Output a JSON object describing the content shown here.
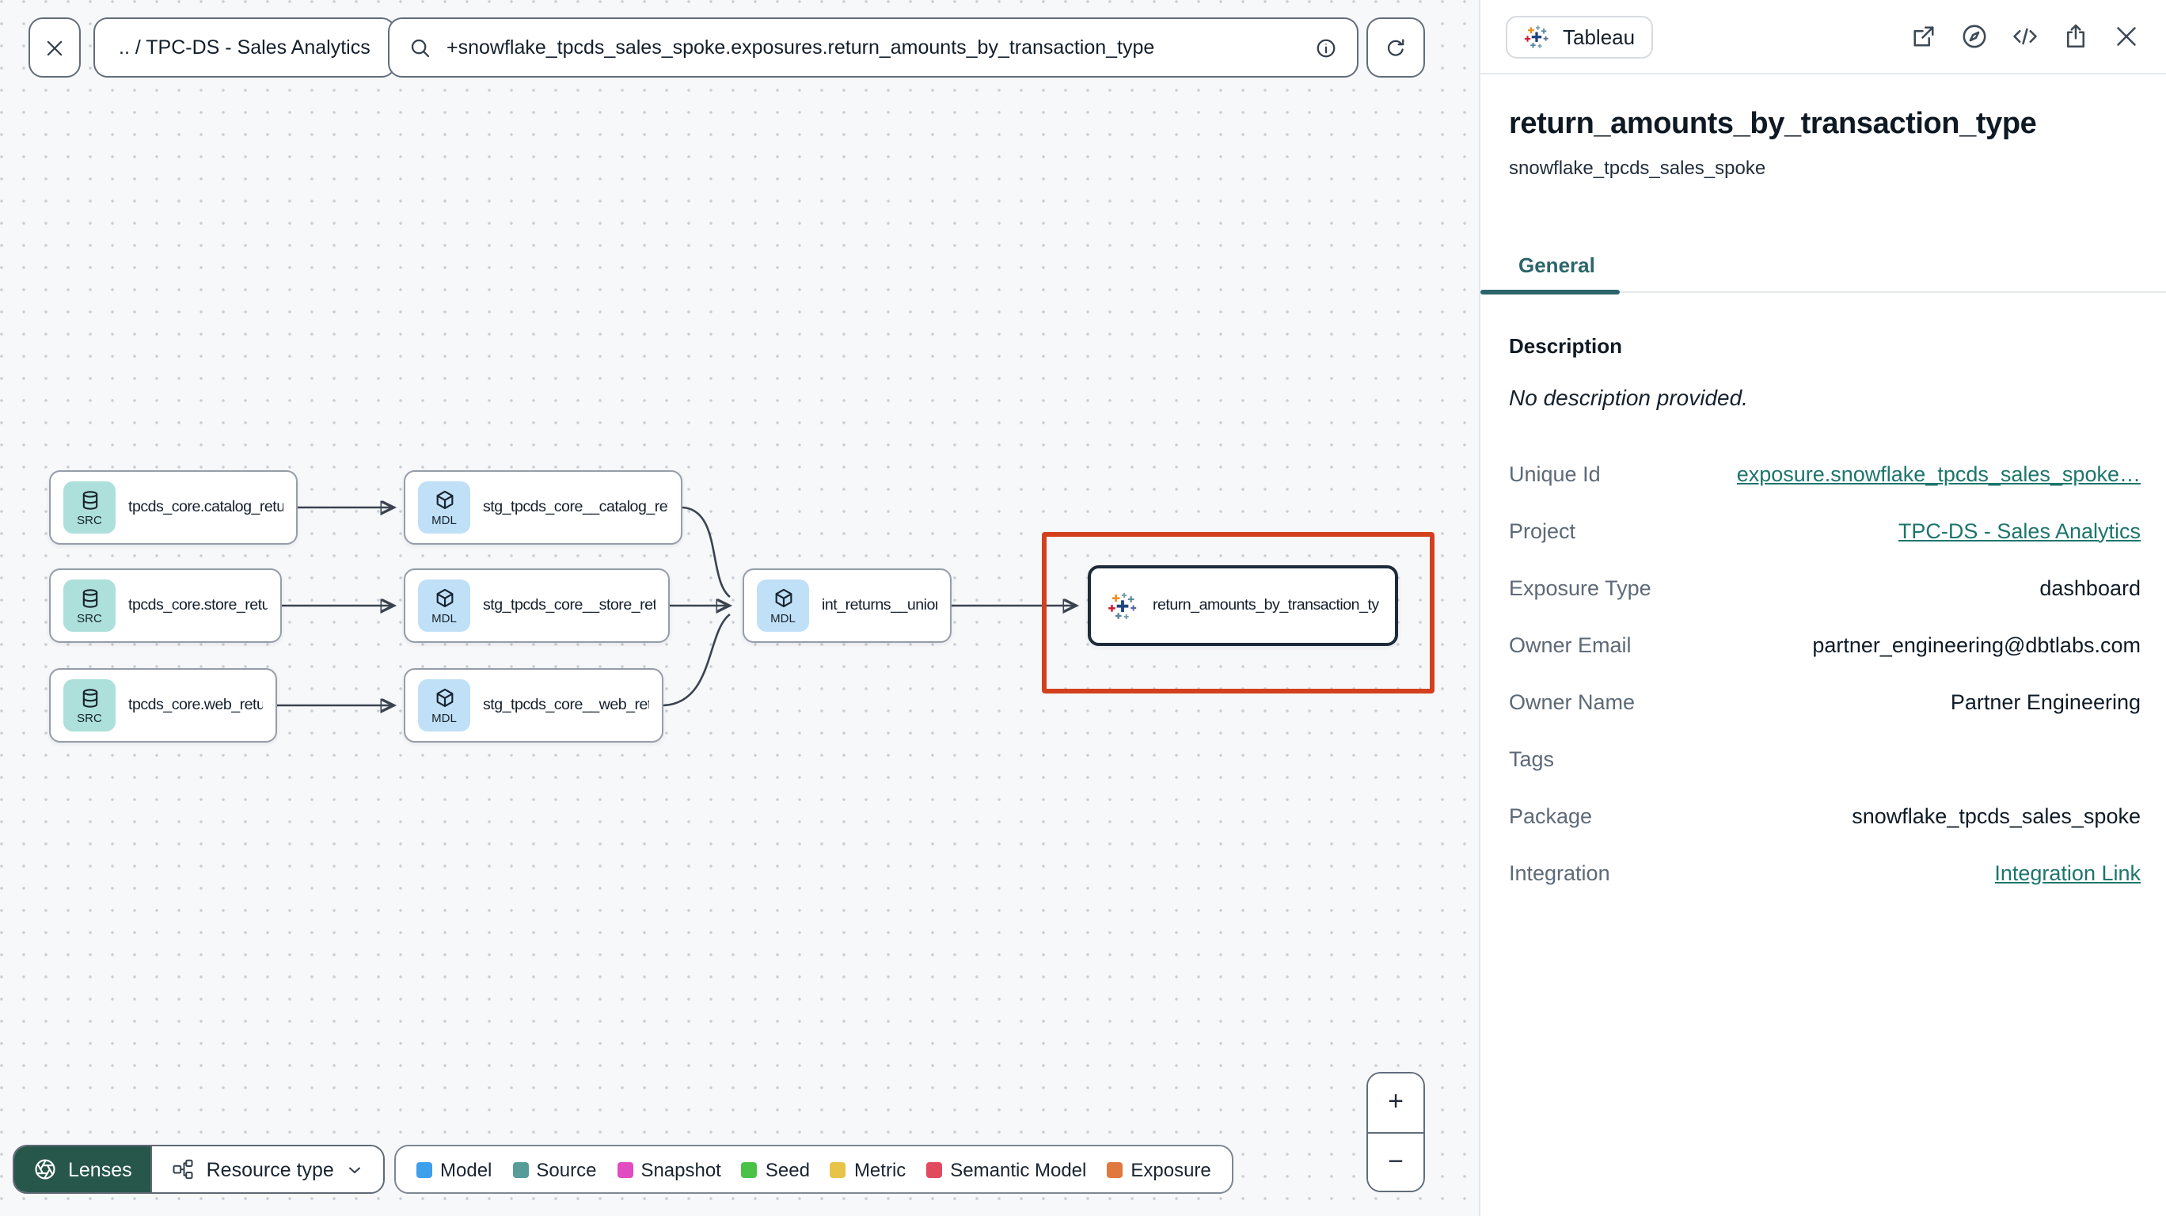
{
  "toolbar": {
    "breadcrumb": ".. / TPC-DS - Sales Analytics",
    "search_value": "+snowflake_tpcds_sales_spoke.exposures.return_amounts_by_transaction_type"
  },
  "graph": {
    "nodes": [
      {
        "badge": "SRC",
        "label": "tpcds_core.catalog_returns"
      },
      {
        "badge": "SRC",
        "label": "tpcds_core.store_returns"
      },
      {
        "badge": "SRC",
        "label": "tpcds_core.web_returns"
      },
      {
        "badge": "MDL",
        "label": "stg_tpcds_core__catalog_returns"
      },
      {
        "badge": "MDL",
        "label": "stg_tpcds_core__store_returns"
      },
      {
        "badge": "MDL",
        "label": "stg_tpcds_core__web_returns"
      },
      {
        "badge": "MDL",
        "label": "int_returns__unioned"
      },
      {
        "badge": "",
        "label": "return_amounts_by_transaction_type"
      }
    ]
  },
  "controls": {
    "lenses_label": "Lenses",
    "resource_type_label": "Resource type",
    "zoom_in": "+",
    "zoom_out": "−"
  },
  "legend": {
    "items": [
      {
        "label": "Model",
        "color": "#3e9fed"
      },
      {
        "label": "Source",
        "color": "#579c99"
      },
      {
        "label": "Snapshot",
        "color": "#e14cc1"
      },
      {
        "label": "Seed",
        "color": "#4ac247"
      },
      {
        "label": "Metric",
        "color": "#e7c348"
      },
      {
        "label": "Semantic Model",
        "color": "#e24a5e"
      },
      {
        "label": "Exposure",
        "color": "#e0793f"
      }
    ]
  },
  "panel": {
    "integration_badge": "Tableau",
    "title": "return_amounts_by_transaction_type",
    "subtitle": "snowflake_tpcds_sales_spoke",
    "tab_general": "General",
    "description_label": "Description",
    "description_value": "No description provided.",
    "fields": [
      {
        "label": "Unique Id",
        "value": "exposure.snowflake_tpcds_sales_spoke…"
      },
      {
        "label": "Project",
        "value": "TPC-DS - Sales Analytics"
      },
      {
        "label": "Exposure Type",
        "value": "dashboard"
      },
      {
        "label": "Owner Email",
        "value": "partner_engineering@dbtlabs.com"
      },
      {
        "label": "Owner Name",
        "value": "Partner Engineering"
      },
      {
        "label": "Tags",
        "value": ""
      },
      {
        "label": "Package",
        "value": "snowflake_tpcds_sales_spoke"
      },
      {
        "label": "Integration",
        "value": "Integration Link"
      }
    ]
  },
  "colors": {
    "accent_teal": "#2d656c",
    "link_teal": "#1d756c",
    "selection_red": "#d3401d",
    "src_badge_bg": "#ade0da",
    "mdl_badge_bg": "#bfe0f7",
    "lenses_bg": "#27564b"
  }
}
